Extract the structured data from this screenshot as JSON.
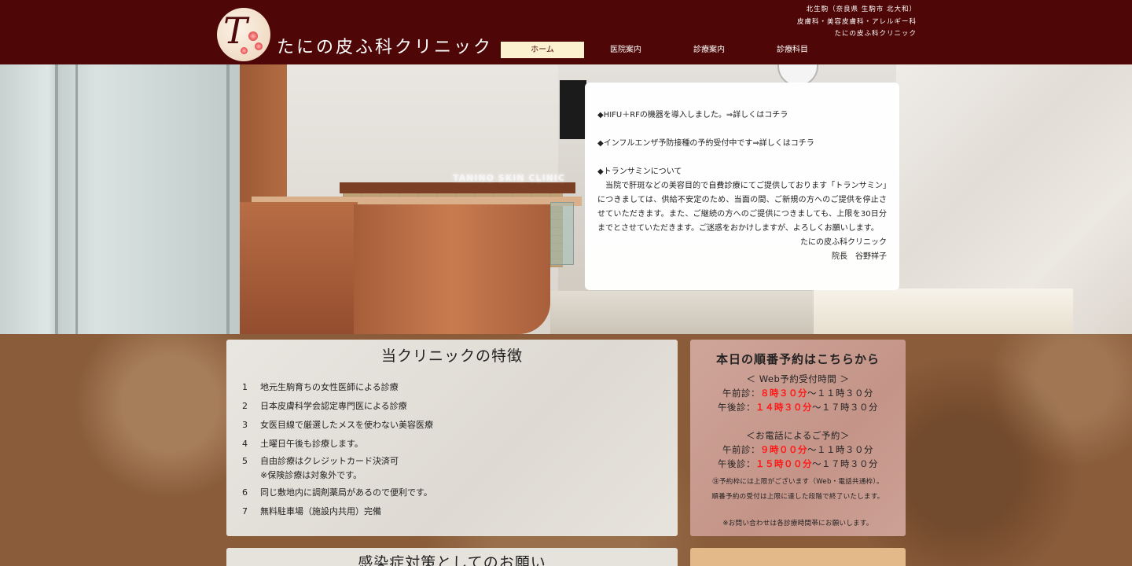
{
  "header": {
    "logo_letter": "T",
    "clinic_name": "たにの皮ふ科クリニック",
    "info_lines": [
      "北生駒（奈良県 生駒市 北大和）",
      "皮膚科・美容皮膚科・アレルギー科",
      "たにの皮ふ科クリニック"
    ]
  },
  "nav": {
    "items": [
      {
        "label": "ホーム",
        "active": true
      },
      {
        "label": "医院案内",
        "active": false
      },
      {
        "label": "診療案内",
        "active": false
      },
      {
        "label": "診療科目",
        "active": false
      }
    ]
  },
  "hero": {
    "sign_text": "TANINO SKIN CLINIC"
  },
  "news": {
    "item1": "◆HIFU＋RFの機器を導入しました。⇒詳しくはコチラ",
    "item2": "◆インフルエンザ予防接種の予約受付中です⇒詳しくはコチラ",
    "item3_title": "◆トランサミンについて",
    "item3_body": "当院で肝斑などの美容目的で自費診療にてご提供しております「トランサミン」につきましては、供給不安定のため、当面の間、ご新規の方へのご提供を停止させていただきます。また、ご継続の方へのご提供につきましても、上限を30日分までとさせていただきます。ご迷惑をおかけしますが、よろしくお願いします。",
    "sign_clinic": "たにの皮ふ科クリニック",
    "sign_doctor": "院長　谷野祥子"
  },
  "features": {
    "title": "当クリニックの特徴",
    "items": [
      {
        "num": "1",
        "text": "地元生駒育ちの女性医師による診療"
      },
      {
        "num": "2",
        "text": "日本皮膚科学会認定専門医による診療"
      },
      {
        "num": "3",
        "text": "女医目線で厳選したメスを使わない美容医療"
      },
      {
        "num": "4",
        "text": "土曜日午後も診療します。"
      },
      {
        "num": "5",
        "text": "自由診療はクレジットカード決済可",
        "note": "※保険診療は対象外です。"
      },
      {
        "num": "6",
        "text": "同じ敷地内に調剤薬局があるので便利です。"
      },
      {
        "num": "7",
        "text": "無料駐車場（施設内共用）完備"
      }
    ]
  },
  "reserve": {
    "title": "本日の順番予約はこちらから",
    "web_heading": "＜ Web予約受付時間 ＞",
    "web_am_label": "午前診：",
    "web_am_start": "８時３０分",
    "web_am_end": "～１１時３０分",
    "web_pm_label": "午後診：",
    "web_pm_start": "１４時３０分",
    "web_pm_end": "～１７時３０分",
    "tel_heading": "＜お電話によるご予約＞",
    "tel_am_label": "午前診：",
    "tel_am_start": "９時００分",
    "tel_am_end": "～１１時３０分",
    "tel_pm_label": "午後診：",
    "tel_pm_start": "１５時００分",
    "tel_pm_end": "～１７時３０分",
    "note1": "㊟予約枠には上限がございます（Web・電話共通枠）。",
    "note2": "順番予約の受付は上限に達した段階で終了いたします。",
    "note3": "※お問い合わせは各診療時間帯にお願いします。"
  },
  "infection": {
    "title": "感染症対策としてのお願い"
  }
}
